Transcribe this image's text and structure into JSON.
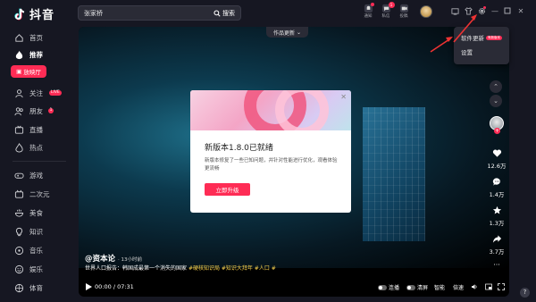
{
  "app": {
    "name": "抖音"
  },
  "search": {
    "value": "张家桥",
    "button_label": "搜索"
  },
  "top_icons": [
    {
      "label": "通知"
    },
    {
      "label": "私信",
      "badge": "1"
    },
    {
      "label": "投稿"
    }
  ],
  "sidebar": {
    "items": [
      {
        "label": "首页"
      },
      {
        "label": "推荐"
      },
      {
        "label": "放映厅"
      },
      {
        "label": "关注",
        "badge": "LIVE"
      },
      {
        "label": "朋友",
        "badge": "1"
      },
      {
        "label": "直播"
      },
      {
        "label": "热点"
      },
      {
        "label": "游戏"
      },
      {
        "label": "二次元"
      },
      {
        "label": "美食"
      },
      {
        "label": "知识"
      },
      {
        "label": "音乐"
      },
      {
        "label": "娱乐"
      },
      {
        "label": "体育"
      }
    ]
  },
  "video": {
    "top_tag": "作品更新",
    "author": "@资本论",
    "time_ago": "· 13小时前",
    "description": "世界人口报告：韩国成最第一个消失的国家",
    "hashtags": "#硬核知识局 #知识大拜年 #人口 #",
    "current_time": "00:00",
    "duration": "07:31",
    "controls": {
      "continuous": "连播",
      "clear_screen": "清屏",
      "smart": "智能",
      "speed": "倍速"
    }
  },
  "actions": {
    "likes": "12.6万",
    "comments": "1.4万",
    "favorites": "1.3万",
    "shares": "3.7万"
  },
  "modal": {
    "title": "新版本1.8.0已就绪",
    "body": "新版本修复了一些已知问题，并针对性能进行优化，观看体验更流畅",
    "button": "立即升级"
  },
  "menu": {
    "items": [
      {
        "label": "软件更新",
        "badge": "有新版本"
      },
      {
        "label": "设置"
      }
    ]
  },
  "colors": {
    "accent": "#fe2c55",
    "background": "#161722"
  }
}
